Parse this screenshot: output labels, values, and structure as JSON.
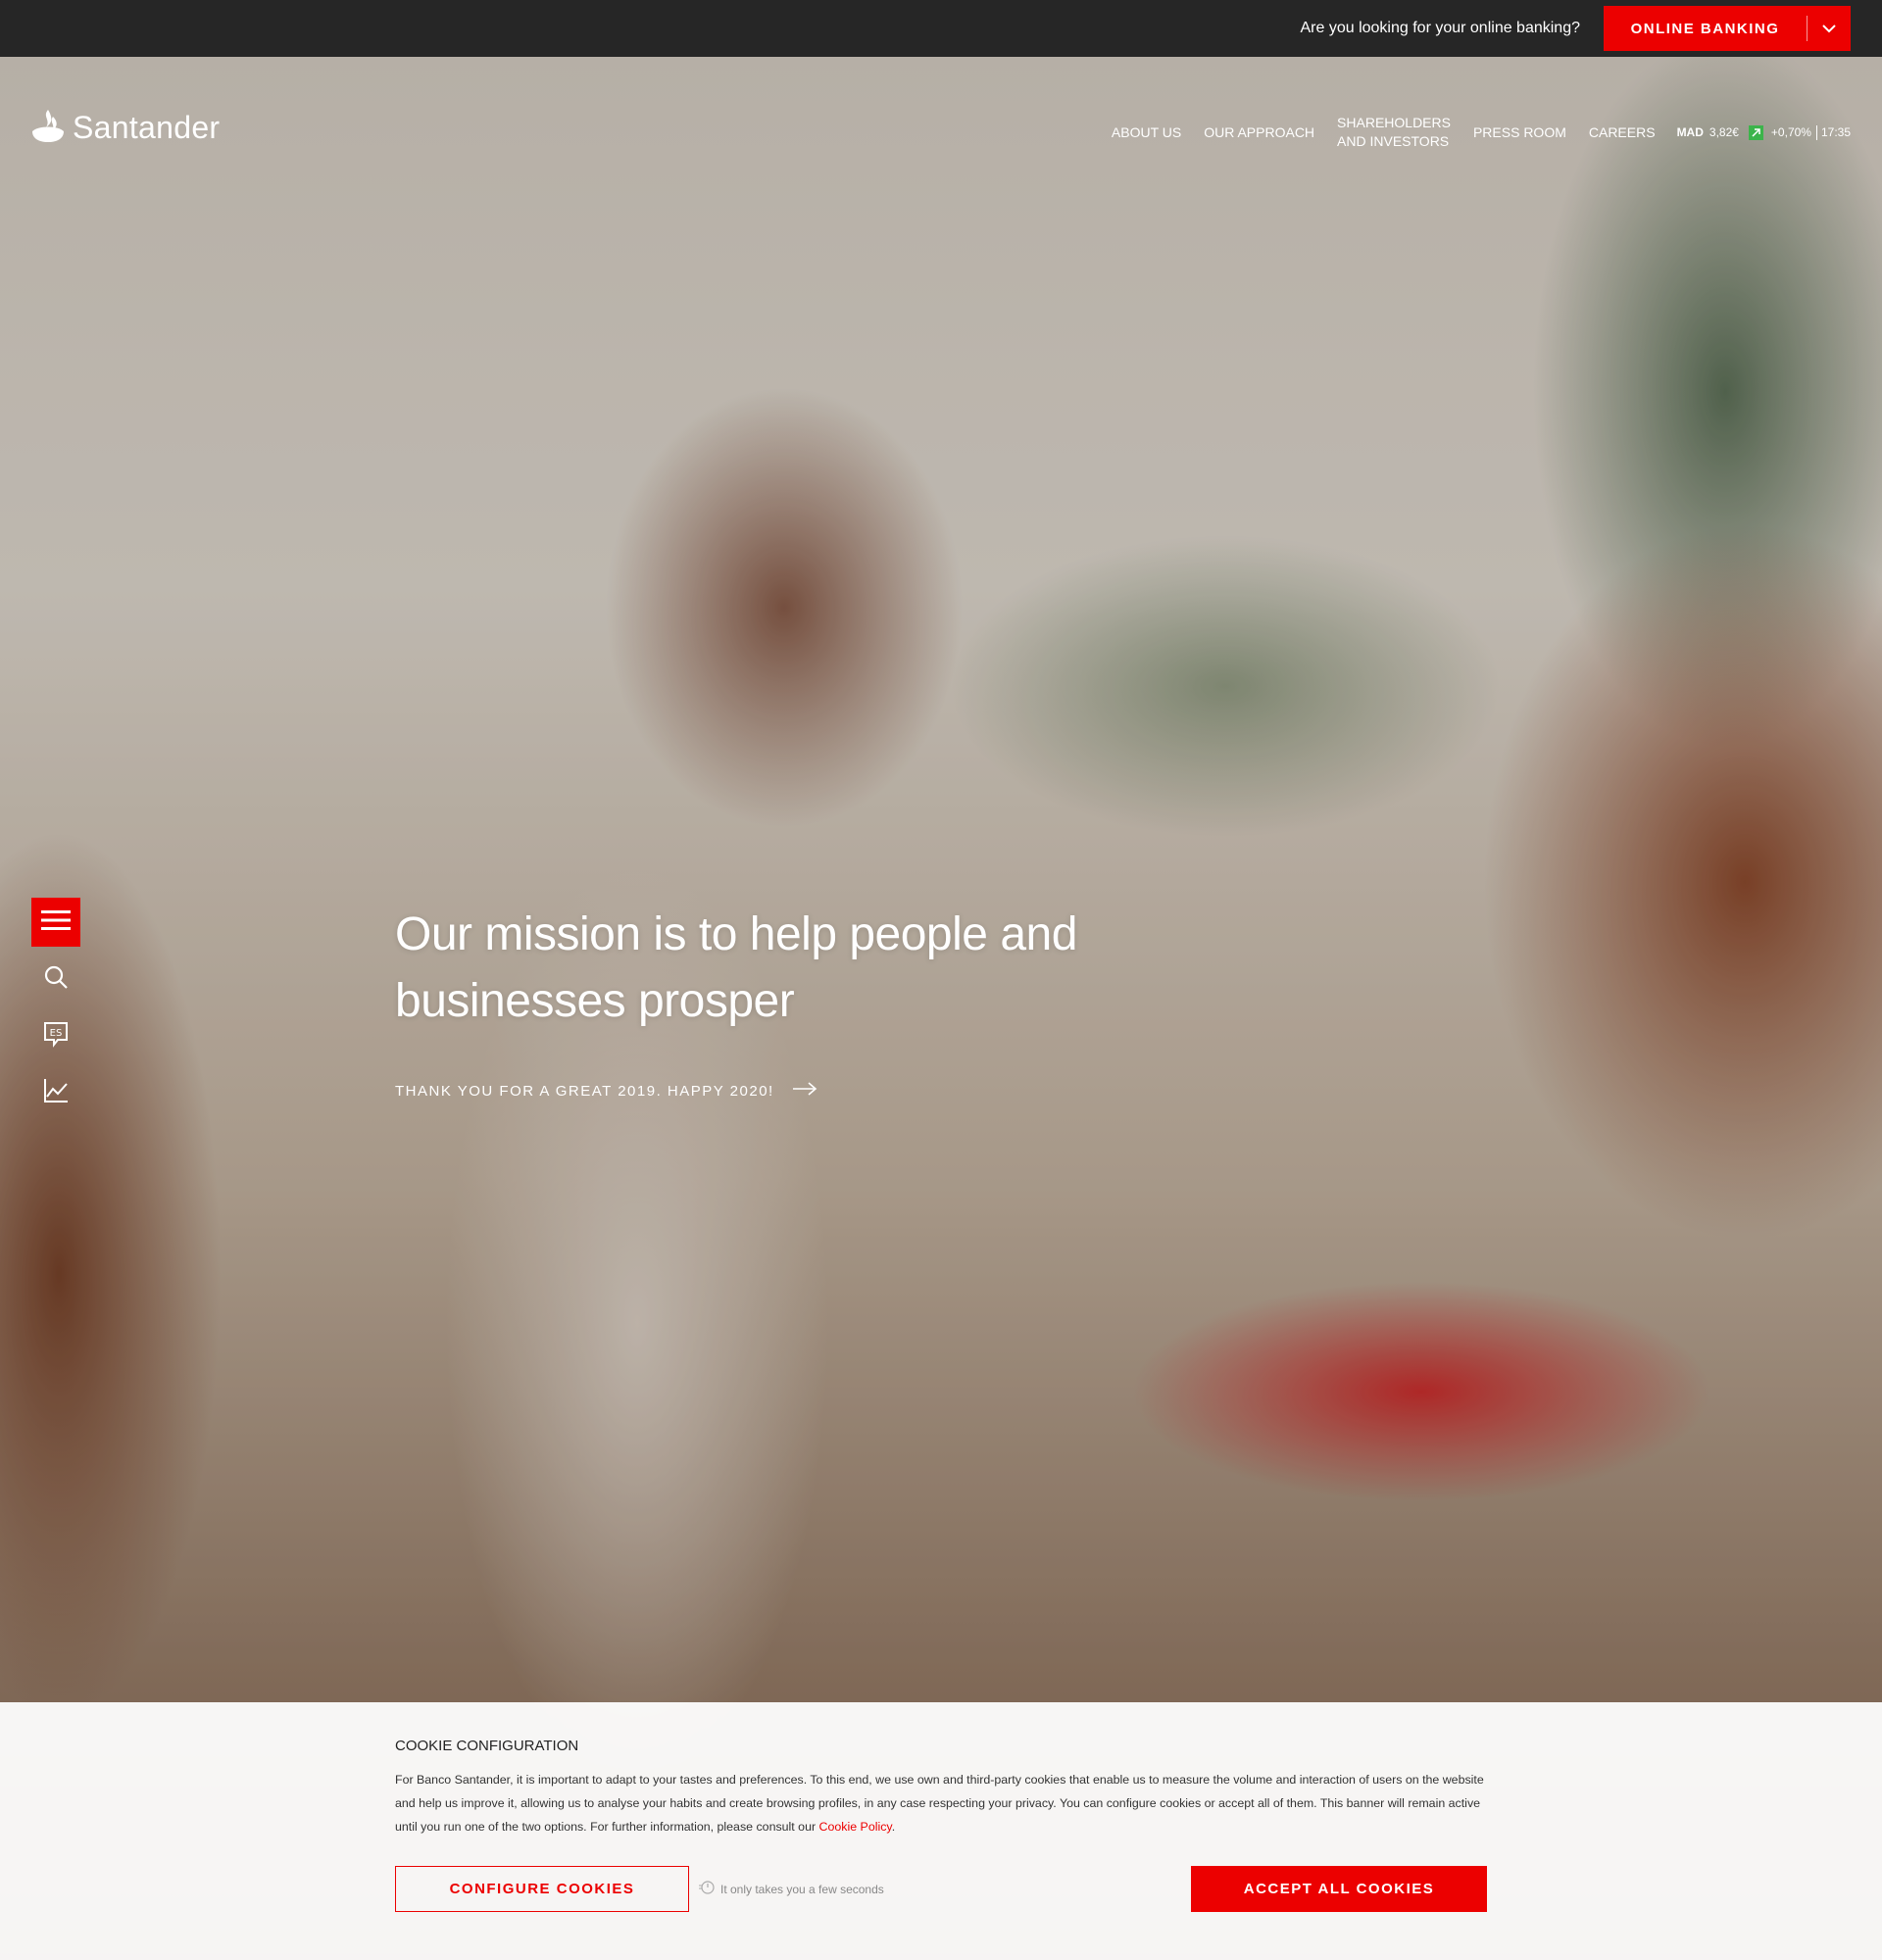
{
  "topbar": {
    "question": "Are you looking for your online banking?",
    "online_banking_label": "ONLINE BANKING"
  },
  "brand": {
    "name": "Santander",
    "color": "#ec0000"
  },
  "nav": {
    "items": [
      {
        "label": "ABOUT US"
      },
      {
        "label": "OUR APPROACH"
      },
      {
        "label_line1": "SHAREHOLDERS",
        "label_line2": "AND INVESTORS"
      },
      {
        "label": "PRESS ROOM"
      },
      {
        "label": "CAREERS"
      }
    ],
    "ticker": {
      "symbol": "MAD",
      "price": "3,82€",
      "change": "+0,70%",
      "time": "17:35"
    }
  },
  "sidebar": {
    "icons": [
      "menu-icon",
      "search-icon",
      "language-es-icon",
      "stock-chart-icon"
    ]
  },
  "hero": {
    "title": "Our mission is to help people and businesses prosper",
    "cta": "THANK YOU FOR A GREAT 2019. HAPPY 2020!"
  },
  "cookie": {
    "title": "COOKIE CONFIGURATION",
    "text": "For Banco Santander, it is important to adapt to your tastes and preferences. To this end, we use own and third-party cookies that enable us to measure the volume and interaction of users on the website and help us improve it, allowing us to analyse your habits and create browsing profiles, in any case respecting your privacy. You can configure cookies or accept all of them. This banner will remain active until you run one of the two options. For further information, please consult our",
    "policy_link": "Cookie Policy",
    "policy_suffix": ".",
    "configure_label": "CONFIGURE COOKIES",
    "hint": "It only takes you a few seconds",
    "accept_label": "ACCEPT ALL COOKIES"
  }
}
